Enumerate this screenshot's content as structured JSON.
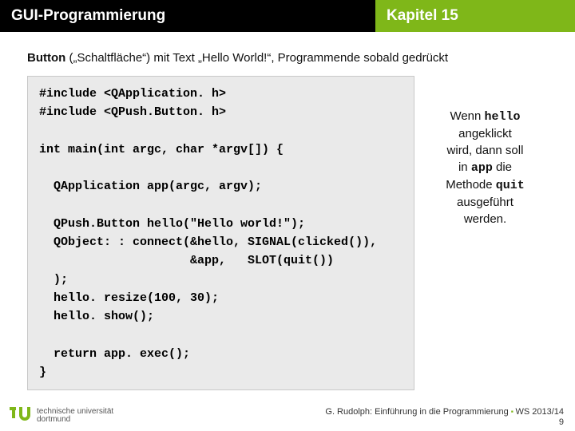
{
  "header": {
    "left": "GUI-Programmierung",
    "right": "Kapitel 15"
  },
  "intro": {
    "bold": "Button",
    "rest": " („Schaltfläche“) mit Text „Hello World!“, Programmende sobald gedrückt"
  },
  "code": "#include <QApplication. h>\n#include <QPush.Button. h>\n\nint main(int argc, char *argv[]) {\n\n  QApplication app(argc, argv);\n\n  QPush.Button hello(\"Hello world!\");\n  QObject: : connect(&hello, SIGNAL(clicked()),\n                     &app,   SLOT(quit())\n  );\n  hello. resize(100, 30);\n  hello. show();\n\n  return app. exec();\n}",
  "side": {
    "p1a": "Wenn ",
    "p1b": "hello",
    "p2": "angeklickt",
    "p3": "wird, dann soll",
    "p4a": "in ",
    "p4b": "app",
    "p4c": " die",
    "p5a": "Methode ",
    "p5b": "quit",
    "p6": "ausgeführt",
    "p7": "werden."
  },
  "footer": {
    "uni1": "technische universität",
    "uni2": "dortmund",
    "credit": "G. Rudolph: Einführung in die Programmierung",
    "sem": "WS 2013/14",
    "page": "9"
  }
}
